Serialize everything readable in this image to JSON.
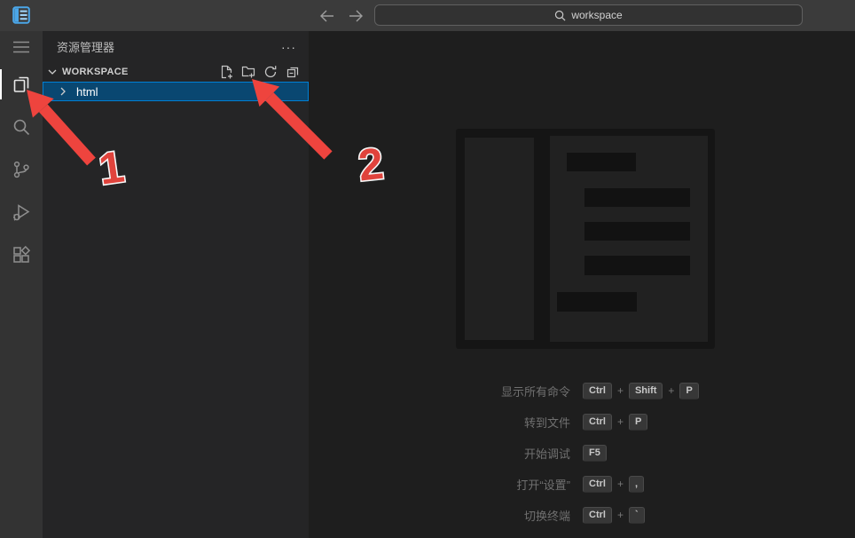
{
  "colors": {
    "titlebar": "#3b3b3b",
    "activitybar": "#333333",
    "sidebar": "#252526",
    "editor": "#1e1e1e",
    "selection_bg": "#094771",
    "selection_border": "#007fd4",
    "annotation_red": "#ee443e"
  },
  "title_bar": {
    "command_center": {
      "value": "workspace"
    }
  },
  "sidebar": {
    "title": "资源管理器",
    "more_actions": "···",
    "section": {
      "label": "WORKSPACE"
    },
    "tree": {
      "item_label": "html"
    }
  },
  "editor": {
    "key_separator": "+",
    "shortcuts": [
      {
        "label": "显示所有命令",
        "keys": [
          "Ctrl",
          "Shift",
          "P"
        ]
      },
      {
        "label": "转到文件",
        "keys": [
          "Ctrl",
          "P"
        ]
      },
      {
        "label": "开始调试",
        "keys": [
          "F5"
        ]
      },
      {
        "label": "打开“设置”",
        "keys": [
          "Ctrl",
          ","
        ]
      },
      {
        "label": "切换终端",
        "keys": [
          "Ctrl",
          "`"
        ]
      }
    ]
  },
  "annotations": {
    "arrow1": {
      "label": "1"
    },
    "arrow2": {
      "label": "2"
    }
  }
}
